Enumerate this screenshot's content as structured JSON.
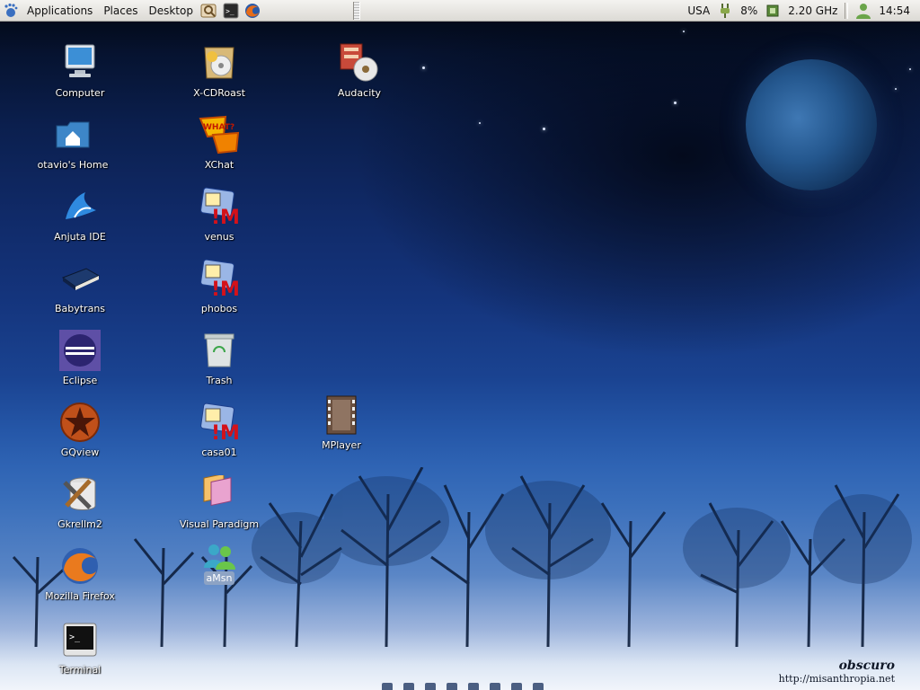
{
  "top_panel": {
    "menus": [
      "Applications",
      "Places",
      "Desktop"
    ],
    "launchers": [
      "search-tool-icon",
      "terminal-icon",
      "firefox-icon"
    ],
    "keyboard_layout": "USA",
    "battery": "8%",
    "cpu_freq": "2.20 GHz",
    "clock": "14:54"
  },
  "desktop": {
    "icons": [
      {
        "id": "computer",
        "label": "Computer",
        "icon": "computer-icon"
      },
      {
        "id": "home",
        "label": "otavio's Home",
        "icon": "home-folder-icon"
      },
      {
        "id": "anjuta",
        "label": "Anjuta IDE",
        "icon": "anjuta-ide-icon"
      },
      {
        "id": "babytrans",
        "label": "Babytrans",
        "icon": "dictionary-book-icon"
      },
      {
        "id": "eclipse",
        "label": "Eclipse",
        "icon": "eclipse-icon"
      },
      {
        "id": "gqview",
        "label": "GQview",
        "icon": "gqview-icon"
      },
      {
        "id": "gkrellm",
        "label": "Gkrellm2",
        "icon": "gkrellm-icon"
      },
      {
        "id": "firefox",
        "label": "Mozilla Firefox",
        "icon": "firefox-icon"
      },
      {
        "id": "terminal",
        "label": "Terminal",
        "icon": "terminal-icon"
      },
      {
        "id": "xcdroast",
        "label": "X-CDRoast",
        "icon": "xcdroast-icon"
      },
      {
        "id": "xchat",
        "label": "XChat",
        "icon": "xchat-icon"
      },
      {
        "id": "venus",
        "label": "venus",
        "icon": "remote-desktop-icon"
      },
      {
        "id": "phobos",
        "label": "phobos",
        "icon": "remote-desktop-icon"
      },
      {
        "id": "trash",
        "label": "Trash",
        "icon": "trash-icon"
      },
      {
        "id": "casa01",
        "label": "casa01",
        "icon": "remote-desktop-icon"
      },
      {
        "id": "visual-paradigm",
        "label": "Visual Paradigm",
        "icon": "visual-paradigm-icon"
      },
      {
        "id": "amsn",
        "label": "aMsn",
        "icon": "amsn-icon"
      },
      {
        "id": "audacity",
        "label": "Audacity",
        "icon": "audacity-icon"
      },
      {
        "id": "mplayer",
        "label": "MPlayer",
        "icon": "mplayer-icon"
      }
    ],
    "selected": "amsn"
  },
  "wallpaper": {
    "brand": "obscuro",
    "url": "http://misanthropia.net"
  }
}
